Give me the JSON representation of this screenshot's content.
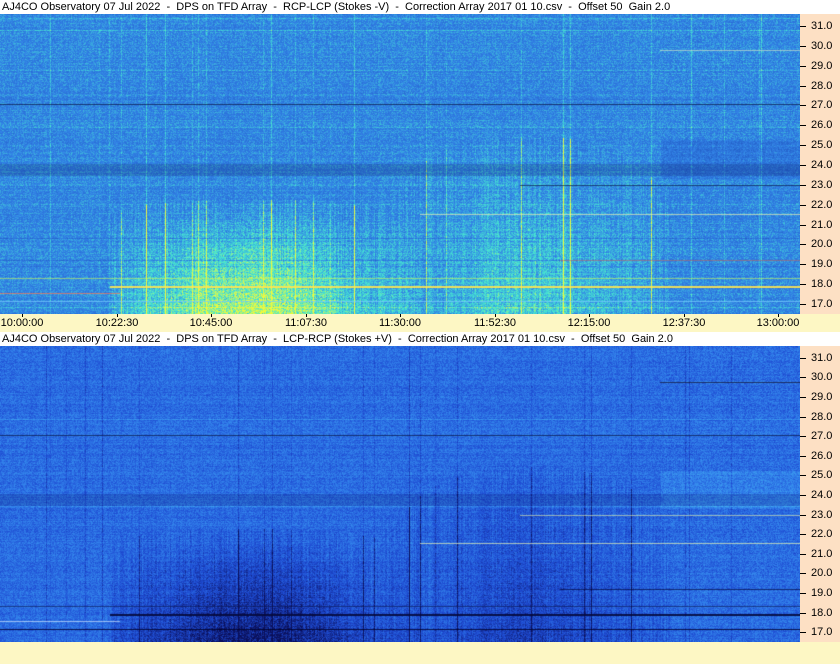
{
  "panels": {
    "top": {
      "title": "AJ4CO Observatory 07 Jul 2022  -  DPS on TFD Array  -  RCP-LCP (Stokes -V)  -  Correction Array 2017 01 10.csv  -  Offset 50  Gain 2.0",
      "polarity": "bright",
      "base_color": "#2f73d8"
    },
    "bottom": {
      "title": "AJ4CO Observatory 07 Jul 2022  -  DPS on TFD Array  -  LCP-RCP (Stokes +V)  -  Correction Array 2017 01 10.csv  -  Offset 50  Gain 2.0",
      "polarity": "dark",
      "base_color": "#2a6fe0"
    }
  },
  "frequency_labels": [
    "31.0",
    "30.0",
    "29.0",
    "28.0",
    "27.0",
    "26.0",
    "25.0",
    "24.0",
    "23.0",
    "22.0",
    "21.0",
    "20.0",
    "19.0",
    "18.0",
    "17.0"
  ],
  "frequency_range": [
    16.5,
    31.6
  ],
  "time_labels": [
    "10:00:00",
    "10:22:30",
    "10:45:00",
    "11:07:30",
    "11:30:00",
    "11:52:30",
    "12:15:00",
    "12:37:30",
    "13:00:00"
  ],
  "colors": {
    "y_axis_bg": "#fde0c4",
    "x_axis_bg": "#fdf7c4"
  }
}
